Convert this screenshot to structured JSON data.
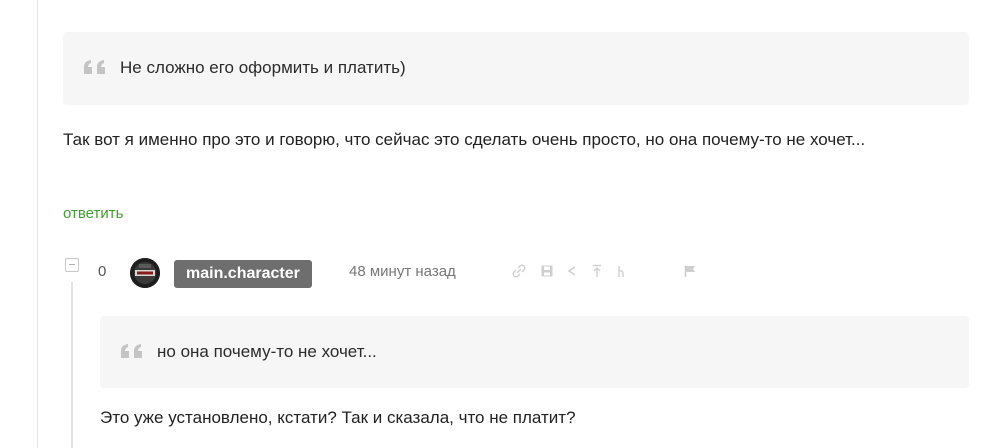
{
  "quotes": {
    "first": "Не сложно его оформить и платить)",
    "second": "но она почему-то не хочет..."
  },
  "comment": {
    "text": "Так вот я именно про это и говорю, что сейчас это сделать очень просто, но она почему-то не хочет...",
    "reply_link": "ответить"
  },
  "reply": {
    "score": "0",
    "username": "main.character",
    "timestamp": "48 минут назад",
    "text": "Это уже установлено, кстати? Так и сказала, что не платит?",
    "actions": [
      "link-icon",
      "save-icon",
      "share-icon",
      "go-to-parent-icon",
      "go-to-root-icon",
      "report-flag-icon"
    ]
  },
  "colors": {
    "reply_link": "#3f9f2c",
    "badge_bg": "#6e6e6e",
    "quote_bg": "#f6f6f6"
  }
}
